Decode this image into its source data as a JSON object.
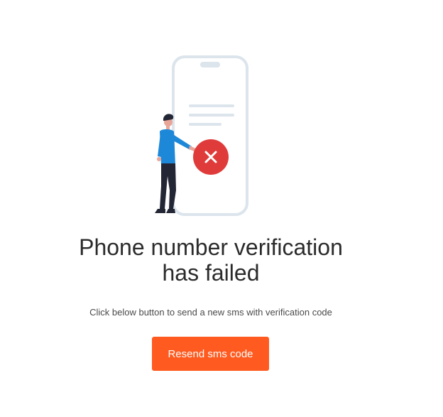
{
  "colors": {
    "accent": "#FF5A1F",
    "error": "#E03B3B",
    "phone_outline": "#DCE4EC",
    "shirt": "#1E88D8",
    "pants": "#232634",
    "title_text": "#2B2B2B"
  },
  "illustration": {
    "icon": "failed-phone-verification-illustration"
  },
  "page": {
    "title_line1": "Phone number verification",
    "title_line2": "has failed",
    "subtitle": "Click below button to send a new sms with verification code"
  },
  "actions": {
    "resend_label": "Resend sms code"
  }
}
